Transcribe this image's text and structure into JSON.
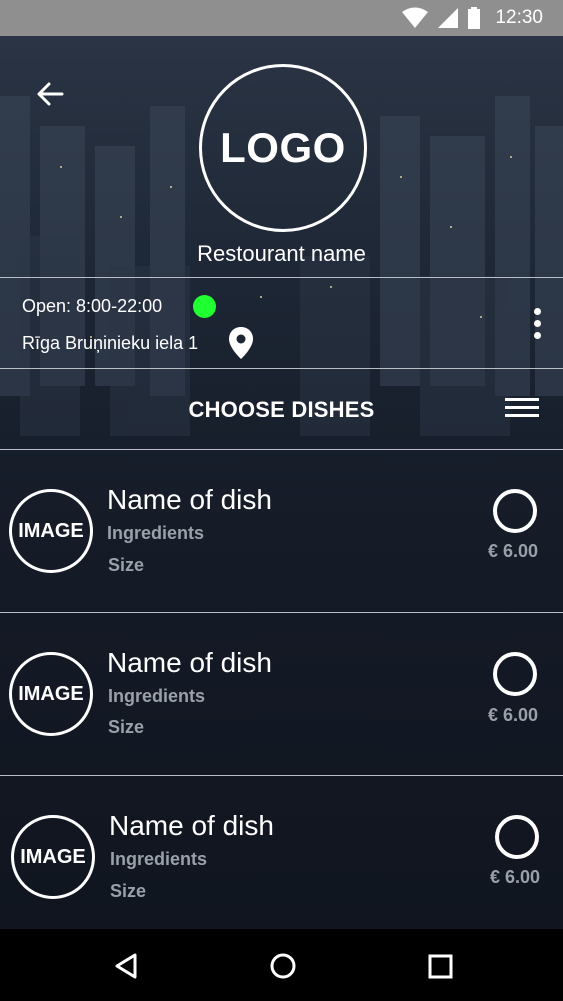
{
  "status_bar": {
    "time": "12:30"
  },
  "header": {
    "logo_text": "LOGO",
    "restaurant_name": "Restourant name"
  },
  "info": {
    "open_hours": "Open: 8:00-22:00",
    "address": "Rīga Bruņinieku iela 1"
  },
  "section": {
    "title": "CHOOSE DISHES"
  },
  "dishes": [
    {
      "image_label": "IMAGE",
      "name": "Name of dish",
      "ingredients": "Ingredients",
      "size": "Size",
      "price": "€ 6.00"
    },
    {
      "image_label": "IMAGE",
      "name": "Name of dish",
      "ingredients": "Ingredients",
      "size": "Size",
      "price": "€ 6.00"
    },
    {
      "image_label": "IMAGE",
      "name": "Name of dish",
      "ingredients": "Ingredients",
      "size": "Size",
      "price": "€ 6.00"
    }
  ],
  "colors": {
    "open_indicator": "#20ff30",
    "background": "#151b27",
    "muted_text": "#9aa0a8",
    "status_bar": "#8f8f8f"
  },
  "icons": [
    "wifi-icon",
    "signal-icon",
    "battery-icon",
    "back-arrow-icon",
    "location-pin-icon",
    "more-vert-icon",
    "menu-icon",
    "nav-back-icon",
    "nav-home-icon",
    "nav-recents-icon"
  ]
}
